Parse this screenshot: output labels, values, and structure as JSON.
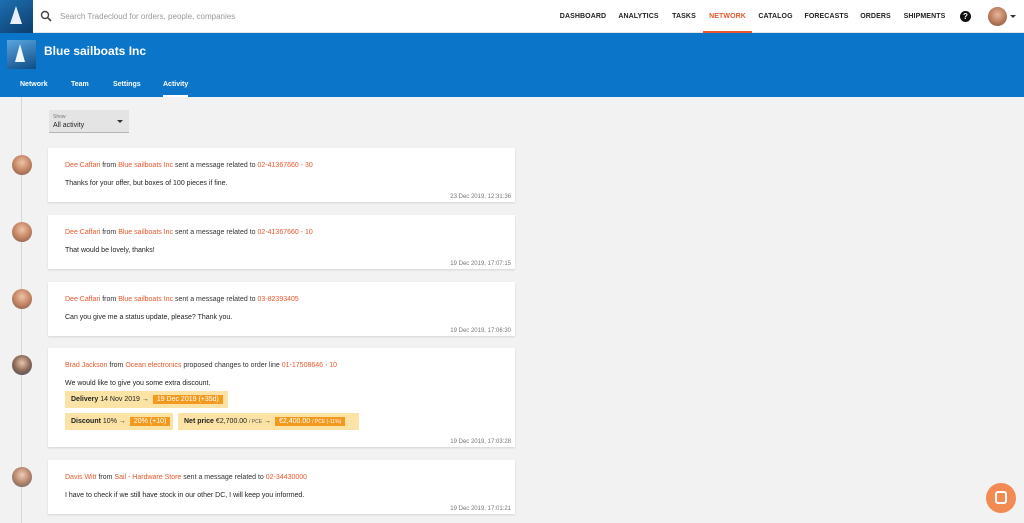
{
  "search": {
    "placeholder": "Search Tradecloud for orders, people, companies"
  },
  "nav": [
    {
      "label": "DASHBOARD"
    },
    {
      "label": "ANALYTICS"
    },
    {
      "label": "TASKS"
    },
    {
      "label": "NETWORK"
    },
    {
      "label": "CATALOG"
    },
    {
      "label": "FORECASTS"
    },
    {
      "label": "ORDERS"
    },
    {
      "label": "SHIPMENTS"
    }
  ],
  "help_icon": "?",
  "company": {
    "name": "Blue sailboats Inc"
  },
  "tabs": [
    {
      "label": "Network"
    },
    {
      "label": "Team"
    },
    {
      "label": "Settings"
    },
    {
      "label": "Activity"
    }
  ],
  "filter": {
    "label": "Show",
    "value": "All activity"
  },
  "colors": {
    "accent": "#e8582e",
    "header": "#0a75c9",
    "chip": "#fbe3a6",
    "chip_highlight": "#f39a1e"
  },
  "feed": [
    {
      "user": "Dee Caffari",
      "from": "from",
      "company": "Blue sailboats Inc",
      "action": "sent a message related to",
      "ref": "02-41367660 - 30",
      "message": "Thanks for your offer, but boxes of 100 pieces if fine.",
      "timestamp": "23 Dec 2019, 12:31:36"
    },
    {
      "user": "Dee Caffari",
      "from": "from",
      "company": "Blue sailboats Inc",
      "action": "sent a message related to",
      "ref": "02-41367660 - 10",
      "message": "That would be lovely, thanks!",
      "timestamp": "19 Dec 2019, 17:07:15"
    },
    {
      "user": "Dee Caffari",
      "from": "from",
      "company": "Blue sailboats Inc",
      "action": "sent a message related to",
      "ref": "03-82393405",
      "message": "Can you give me a status update, please? Thank you.",
      "timestamp": "19 Dec 2019, 17:06:30"
    },
    {
      "user": "Brad Jackson",
      "from": "from",
      "company": "Ocean electronics",
      "action": "proposed changes to order line",
      "ref": "01-17508646 - 10",
      "message": "We would like to give you some extra discount.",
      "timestamp": "19 Dec 2019, 17:03:28",
      "changes": {
        "delivery": {
          "label": "Delivery",
          "old": "14 Nov 2019",
          "arrow": "→",
          "new": "19 Dec 2019 (+35d)"
        },
        "discount": {
          "label": "Discount",
          "old": "10%",
          "arrow": "→",
          "new": "20% (+10)"
        },
        "net_price": {
          "label": "Net price",
          "old": "€2,700.00",
          "old_unit": "/ PCE",
          "arrow": "→",
          "new": "€2,400.00",
          "new_unit": "/ PCE (-11%)"
        }
      }
    },
    {
      "user": "Davis Witt",
      "from": "from",
      "company": "Sail - Hardware Store",
      "action": "sent a message related to",
      "ref": "02-34430000",
      "message": "I have to check if we still have stock in our other DC, I will keep you informed.",
      "timestamp": "19 Dec 2019, 17:01:21"
    }
  ]
}
